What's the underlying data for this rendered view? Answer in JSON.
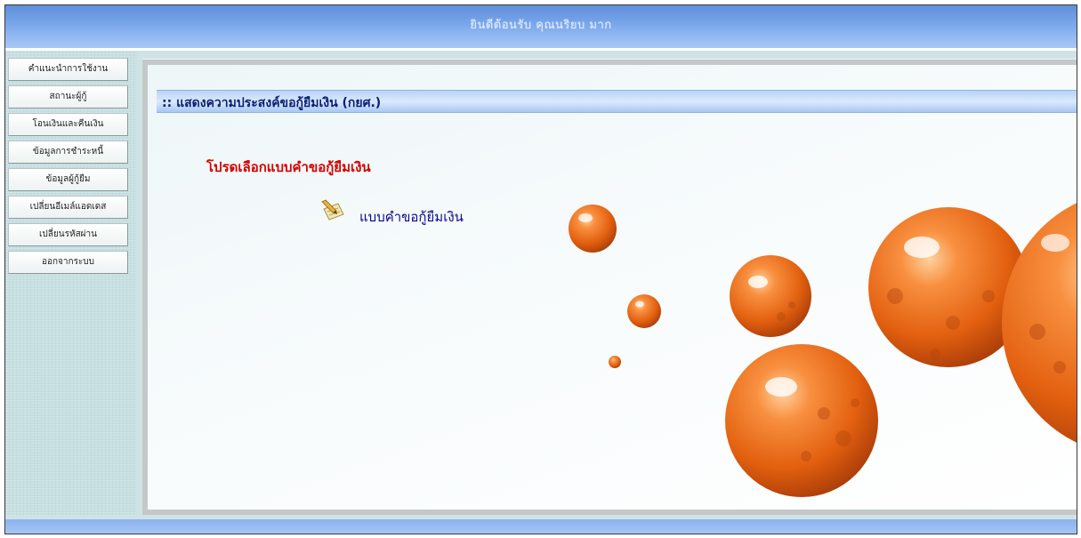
{
  "header": {
    "title": "ยินดีต้อนรับ คุณนริยบ มาก"
  },
  "sidebar": {
    "items": [
      {
        "label": "คำแนะนำการใช้งาน"
      },
      {
        "label": "สถานะผู้กู้"
      },
      {
        "label": "โอนเงินและคืนเงิน"
      },
      {
        "label": "ข้อมูลการชำระหนี้"
      },
      {
        "label": "ข้อมูลผู้กู้ยืม"
      },
      {
        "label": "เปลี่ยนอีเมล์แอดเดส"
      },
      {
        "label": "เปลี่ยนรหัสผ่าน"
      },
      {
        "label": "ออกจากระบบ"
      }
    ]
  },
  "main": {
    "heading": ":: แสดงความประสงค์ขอกู้ยืมเงิน (กยศ.)",
    "prompt": "โปรดเลือกแบบคำขอกู้ยืมเงิน",
    "form_link": {
      "label": "แบบคำขอกู้ยืมเงิน",
      "icon": "pencil-paper-icon"
    }
  },
  "colors": {
    "header_blue": "#7aa7ec",
    "heading_text": "#0b1f76",
    "prompt_red": "#d60000",
    "link_blue": "#0a0a8c",
    "bubble_orange": "#e86a1a"
  }
}
